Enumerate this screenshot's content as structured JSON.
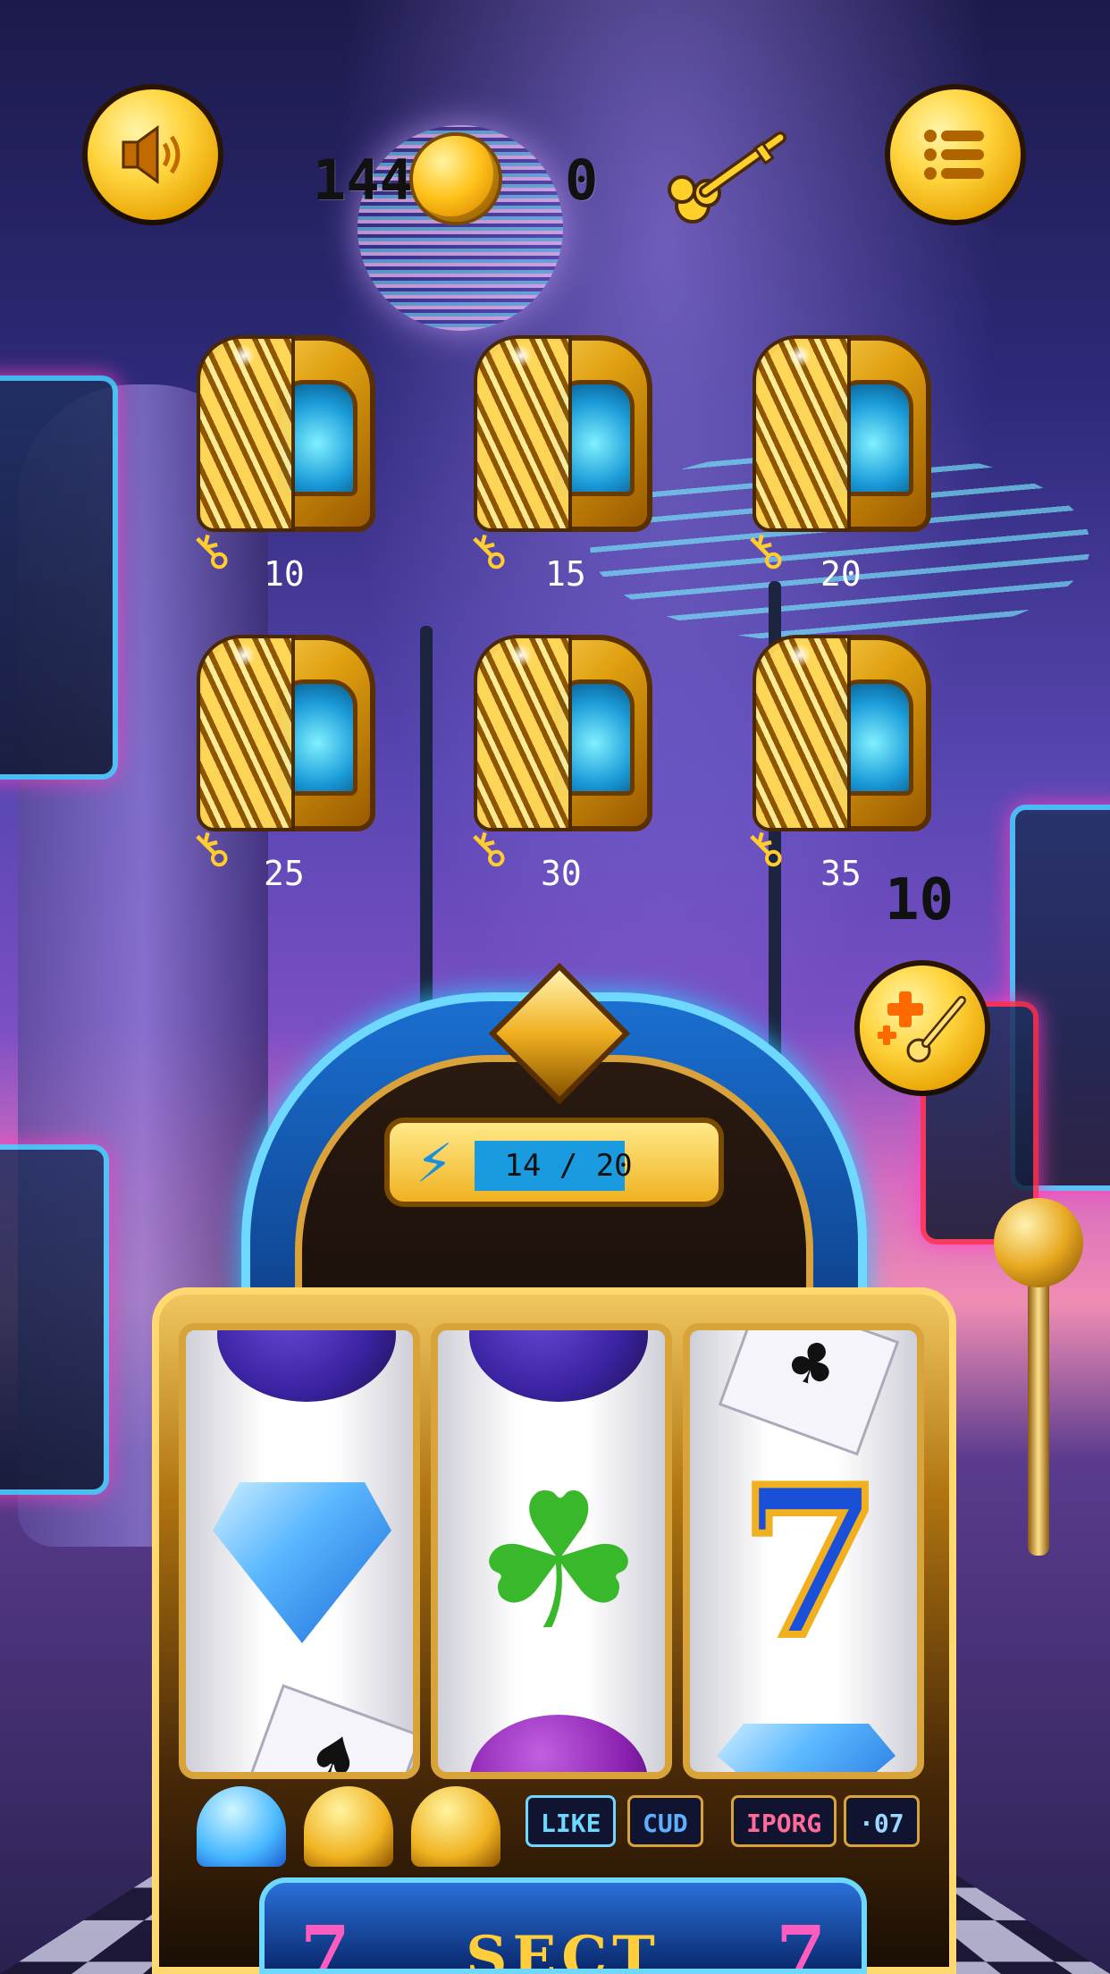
{
  "header": {
    "sound_icon": "speaker-icon",
    "menu_icon": "menu-list-icon",
    "coins": "144",
    "keys": "0"
  },
  "chests": [
    {
      "cost": "10"
    },
    {
      "cost": "15"
    },
    {
      "cost": "20"
    },
    {
      "cost": "25"
    },
    {
      "cost": "30"
    },
    {
      "cost": "35"
    }
  ],
  "free_keys": {
    "count": "10",
    "icon": "add-key-icon"
  },
  "energy": {
    "current": 14,
    "max": 20,
    "label": "14 / 20"
  },
  "reels": [
    {
      "top": "purple-ball",
      "center": "diamond",
      "bottom": "spade-card"
    },
    {
      "top": "purple-ball",
      "center": "four-leaf-clover",
      "bottom": "purple-ball"
    },
    {
      "top": "club-card",
      "center": "seven",
      "bottom": "diamond"
    }
  ],
  "machine_tags": [
    "LIKE",
    "CUD",
    "IPORG",
    "·07"
  ],
  "sign": {
    "text": "SECT"
  },
  "colors": {
    "gold": "#ffd43d",
    "energy_blue": "#1a9be0",
    "neon_cyan": "#6fd8ff"
  }
}
